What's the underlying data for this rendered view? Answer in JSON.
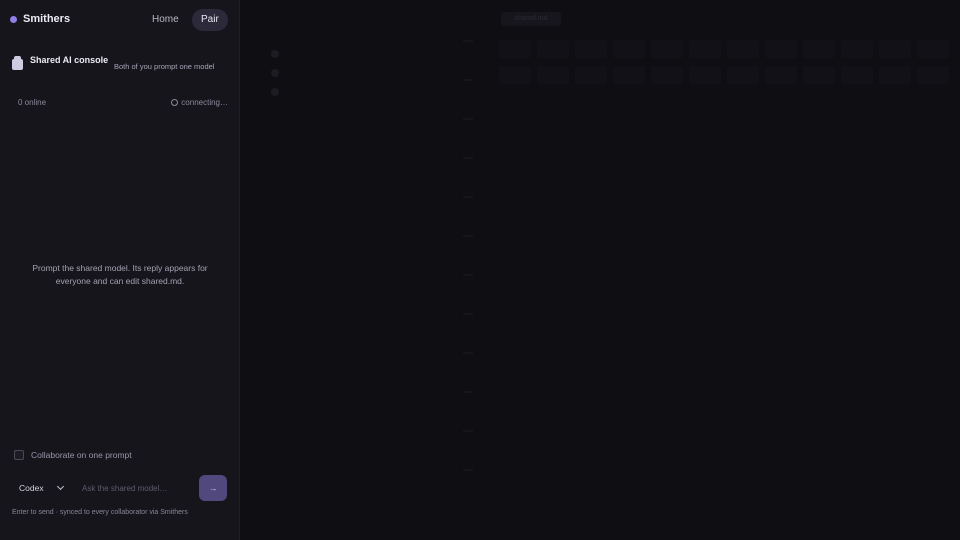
{
  "app": {
    "brand": "Smithers",
    "nav": {
      "home": "Home",
      "pair": "Pair"
    }
  },
  "console": {
    "title": "Shared AI console",
    "subtitle": "Both of you prompt one model",
    "online": "0 online",
    "connecting": "connecting…",
    "empty_message": "Prompt the shared model. Its reply appears for everyone and can edit shared.md.",
    "collaborate_label": "Collaborate on one prompt",
    "collaborate_checked": false,
    "model_selected": "Codex",
    "input_placeholder": "Ask the shared model…",
    "input_value": "",
    "send_label": "→",
    "hint": "Enter to send · synced to every collaborator via Smithers"
  },
  "main": {
    "center_label": "shared.md",
    "right_label": "",
    "list_items": [
      "",
      "",
      ""
    ]
  },
  "colors": {
    "accent": "#8f7fe8",
    "send_button": "#51487d",
    "sidebar_bg": "#16151c",
    "main_bg": "#0f0e13"
  },
  "icons": {
    "brand": "brand-dot-icon",
    "console": "console-icon",
    "connecting": "spinner-icon",
    "model_select": "chevron-down-icon"
  }
}
